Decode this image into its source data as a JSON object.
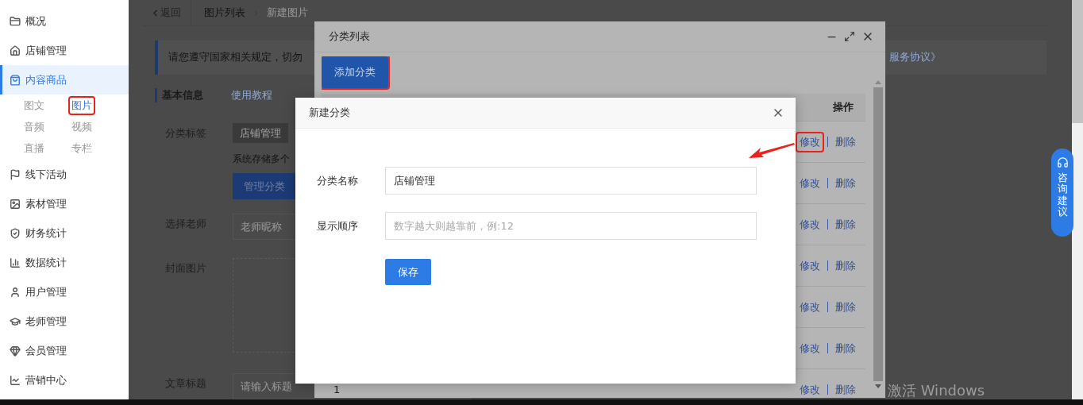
{
  "sidebar": {
    "items": [
      {
        "label": "概况",
        "selected": false
      },
      {
        "label": "店铺管理",
        "selected": false
      },
      {
        "label": "内容商品",
        "selected": true,
        "children": [
          {
            "label": "图文",
            "selected": false,
            "highlighted": false
          },
          {
            "label": "图片",
            "selected": true,
            "highlighted": true
          },
          {
            "label": "音频",
            "selected": false,
            "highlighted": false
          },
          {
            "label": "视频",
            "selected": false,
            "highlighted": false
          },
          {
            "label": "直播",
            "selected": false,
            "highlighted": false
          },
          {
            "label": "专栏",
            "selected": false,
            "highlighted": false
          }
        ]
      },
      {
        "label": "线下活动",
        "selected": false
      },
      {
        "label": "素材管理",
        "selected": false
      },
      {
        "label": "财务统计",
        "selected": false
      },
      {
        "label": "数据统计",
        "selected": false
      },
      {
        "label": "用户管理",
        "selected": false
      },
      {
        "label": "老师管理",
        "selected": false
      },
      {
        "label": "会员管理",
        "selected": false
      },
      {
        "label": "营销中心",
        "selected": false
      }
    ]
  },
  "breadcrumb": {
    "back": "返回",
    "items": [
      "图片列表",
      "新建图片"
    ]
  },
  "notice": {
    "text_start": "请您遵守国家相关规定，切勿",
    "text_end": "服务协议》"
  },
  "section": {
    "title": "基本信息",
    "link": "使用教程"
  },
  "form": {
    "fields": [
      {
        "kind": "tag",
        "label": "分类标签",
        "value": "店铺管理",
        "hint": "系统存储多个",
        "button": "管理分类"
      },
      {
        "kind": "input",
        "label": "选择老师",
        "placeholder": "老师昵称"
      },
      {
        "kind": "upload",
        "label": "封面图片"
      },
      {
        "kind": "input",
        "label": "文章标题",
        "placeholder": "请输入标题"
      }
    ]
  },
  "category_list_dialog": {
    "title": "分类列表",
    "add_button": {
      "label": "添加分类",
      "highlighted": true
    },
    "table": {
      "columns": [
        "操作"
      ],
      "rows": [
        {
          "actions": [
            {
              "label": "修改",
              "highlighted": true
            },
            {
              "label": "删除",
              "highlighted": false
            }
          ]
        },
        {
          "actions": [
            {
              "label": "修改",
              "highlighted": false
            },
            {
              "label": "删除",
              "highlighted": false
            }
          ]
        },
        {
          "actions": [
            {
              "label": "修改",
              "highlighted": false
            },
            {
              "label": "删除",
              "highlighted": false
            }
          ]
        },
        {
          "actions": [
            {
              "label": "修改",
              "highlighted": false
            },
            {
              "label": "删除",
              "highlighted": false
            }
          ]
        },
        {
          "actions": [
            {
              "label": "修改",
              "highlighted": false
            },
            {
              "label": "删除",
              "highlighted": false
            }
          ]
        },
        {
          "actions": [
            {
              "label": "修改",
              "highlighted": false
            },
            {
              "label": "删除",
              "highlighted": false
            }
          ]
        },
        {
          "column_1": "1",
          "actions": [
            {
              "label": "修改",
              "highlighted": false
            },
            {
              "label": "删除",
              "highlighted": false
            }
          ]
        }
      ]
    }
  },
  "new_category_dialog": {
    "title": "新建分类",
    "fields": [
      {
        "label": "分类名称",
        "value": "店铺管理"
      },
      {
        "label": "显示顺序",
        "placeholder": "数字越大则越靠前，例:12"
      }
    ],
    "save_button": "保存"
  },
  "float_button": "咨询建议",
  "os_watermark": "激活 Windows"
}
